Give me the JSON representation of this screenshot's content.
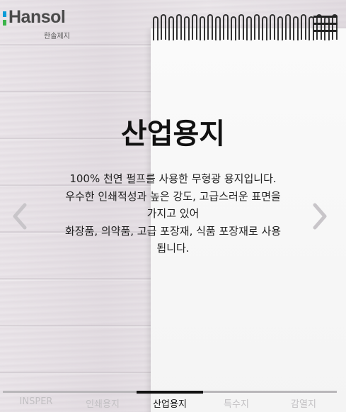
{
  "brand": {
    "name": "Hansol",
    "sub": "한솔제지",
    "colors": {
      "top_mark": "#0a9bd7",
      "bottom_mark": "#3cb44a"
    }
  },
  "header": {
    "menu_icon": "hamburger-icon"
  },
  "slide": {
    "title": "산업용지",
    "description_lines": [
      "100% 천연 펄프를 사용한 무형광 용지입니다.",
      "우수한 인쇄적성과 높은 강도, 고급스러운 표면을",
      "가지고 있어",
      "화장품, 의약품, 고급 포장재, 식품 포장재로 사용",
      "됩니다."
    ],
    "prev_icon": "chevron-left-icon",
    "next_icon": "chevron-right-icon"
  },
  "tabs": {
    "items": [
      {
        "label": "INSPER"
      },
      {
        "label": "인쇄용지"
      },
      {
        "label": "산업용지"
      },
      {
        "label": "특수지"
      },
      {
        "label": "감열지"
      }
    ],
    "active_index": 2
  }
}
